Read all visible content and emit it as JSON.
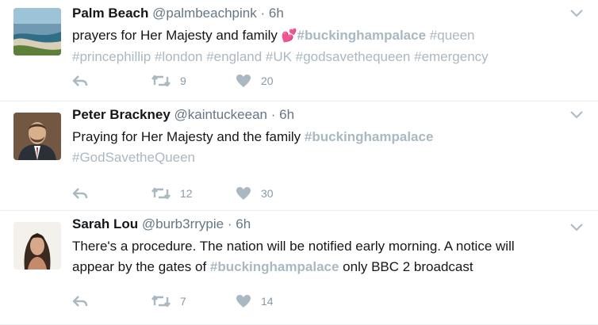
{
  "tweets": [
    {
      "name": "Palm Beach",
      "handle": "@palmbeachpink",
      "sep": "·",
      "time": "6h",
      "text_pre": "prayers for Her Majesty and family",
      "emoji": "💕",
      "tags_line1": [
        "#buckinghampalace",
        "#queen"
      ],
      "tags_line2": [
        "#princephillip",
        "#london",
        "#england",
        "#UK",
        "#godsavethequeen",
        "#emergency"
      ],
      "retweets": "9",
      "likes": "20"
    },
    {
      "name": "Peter Brackney",
      "handle": "@kaintuckeean",
      "sep": "·",
      "time": "6h",
      "text_pre": "Praying for Her Majesty and the family",
      "tag_inline": "#buckinghampalace",
      "tag_line2": "#GodSavetheQueen",
      "retweets": "12",
      "likes": "30"
    },
    {
      "name": "Sarah Lou",
      "handle": "@burb3rrypie",
      "sep": "·",
      "time": "6h",
      "line1": "There's a procedure. The nation will be notified early morning. A notice will",
      "line2_pre": "appear by the gates of",
      "tag_inline": "#buckinghampalace",
      "line2_post": "only BBC 2 broadcast",
      "retweets": "7",
      "likes": "14"
    }
  ],
  "icons": {
    "reply": "reply-icon",
    "retweet": "retweet-icon",
    "like": "heart-icon",
    "more": "chevron-down-icon"
  },
  "colors": {
    "hashtag": "#aab8c2",
    "action_gray": "#aab8c2",
    "divider": "#e6ecf0"
  }
}
